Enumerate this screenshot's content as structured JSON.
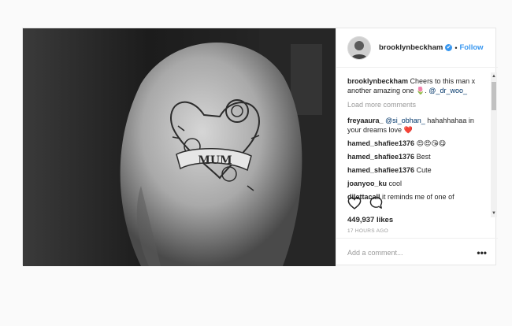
{
  "post": {
    "username": "brooklynbeckham",
    "verified_symbol": "✔",
    "separator": "•",
    "follow_label": "Follow",
    "tattoo_text": "MUM",
    "caption": {
      "username": "brooklynbeckham",
      "text": "Cheers to this man x another amazing one 🌷.",
      "mention": "@_dr_woo_"
    },
    "load_more_label": "Load more comments",
    "comments": [
      {
        "username": "freyaaura_",
        "mention": "@si_obhan_",
        "text": "hahahhahaa in your dreams love ❤️"
      },
      {
        "username": "hamed_shafiee1376",
        "mention": "",
        "text": "😍😍😘😋"
      },
      {
        "username": "hamed_shafiee1376",
        "mention": "",
        "text": "Best"
      },
      {
        "username": "hamed_shafiee1376",
        "mention": "",
        "text": "Cute"
      },
      {
        "username": "joanyoo_ku",
        "mention": "",
        "text": "cool"
      },
      {
        "username": "dilettacall",
        "mention": "",
        "text": "it reminds me of one of"
      }
    ],
    "likes_text": "449,937 likes",
    "timestamp": "17 HOURS AGO",
    "comment_placeholder": "Add a comment...",
    "more_options_label": "•••",
    "scroll_up": "▲",
    "scroll_down": "▼"
  },
  "icons": {
    "like": "heart-icon",
    "comment": "comment-bubble-icon",
    "verified": "verified-badge-icon",
    "more": "more-options-icon"
  },
  "colors": {
    "accent": "#3897f0",
    "mention": "#003569",
    "muted": "#999999",
    "border": "#efefef"
  }
}
